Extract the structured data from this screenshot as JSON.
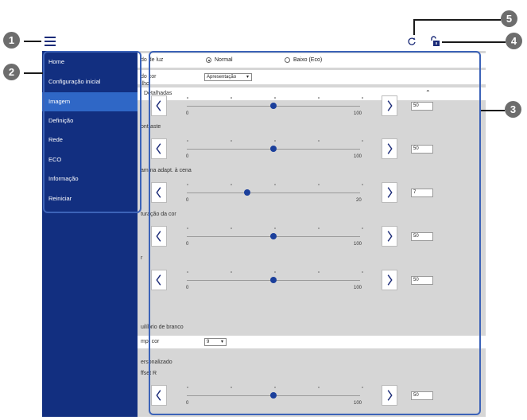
{
  "callouts": [
    "1",
    "2",
    "3",
    "4",
    "5"
  ],
  "sidebar": {
    "items": [
      {
        "label": "Home"
      },
      {
        "label": "Configuração inicial"
      },
      {
        "label": "Imagem"
      },
      {
        "label": "Definição"
      },
      {
        "label": "Rede"
      },
      {
        "label": "ECO"
      },
      {
        "label": "Informação"
      },
      {
        "label": "Reiniciar"
      }
    ],
    "active_index": 2
  },
  "content": {
    "light_mode": {
      "label": "do de luz",
      "option1": "Normal",
      "option2": "Baixo (Eco)",
      "selected": "Normal"
    },
    "color_mode": {
      "label": "do cor",
      "value": "Apresentação"
    },
    "details": {
      "label": "Detalhadas"
    },
    "sliders": [
      {
        "label": "ilho",
        "min": "0",
        "max": "100",
        "value": "50",
        "position": 0.5
      },
      {
        "label": "ontraste",
        "min": "0",
        "max": "100",
        "value": "50",
        "position": 0.5
      },
      {
        "label": "amma adapt. à cena",
        "min": "0",
        "max": "20",
        "value": "7",
        "position": 0.35
      },
      {
        "label": "turação da cor",
        "min": "0",
        "max": "100",
        "value": "50",
        "position": 0.5
      },
      {
        "label": "r",
        "min": "0",
        "max": "100",
        "value": "50",
        "position": 0.5
      }
    ],
    "white_balance": {
      "label": "uilíbrio de branco"
    },
    "color_temp": {
      "label": "mp. cor",
      "value": "9"
    },
    "custom": {
      "label": "ersonalizado"
    },
    "offset_r": {
      "label": "ffset R",
      "min": "0",
      "max": "100",
      "value": "50",
      "position": 0.5
    }
  },
  "colors": {
    "sidebar": "#122f80",
    "active": "#2f67c6",
    "highlight": "#3c63b8",
    "knob": "#1b3f9b"
  },
  "icons": [
    "menu-icon",
    "refresh-icon",
    "lock-icon"
  ]
}
